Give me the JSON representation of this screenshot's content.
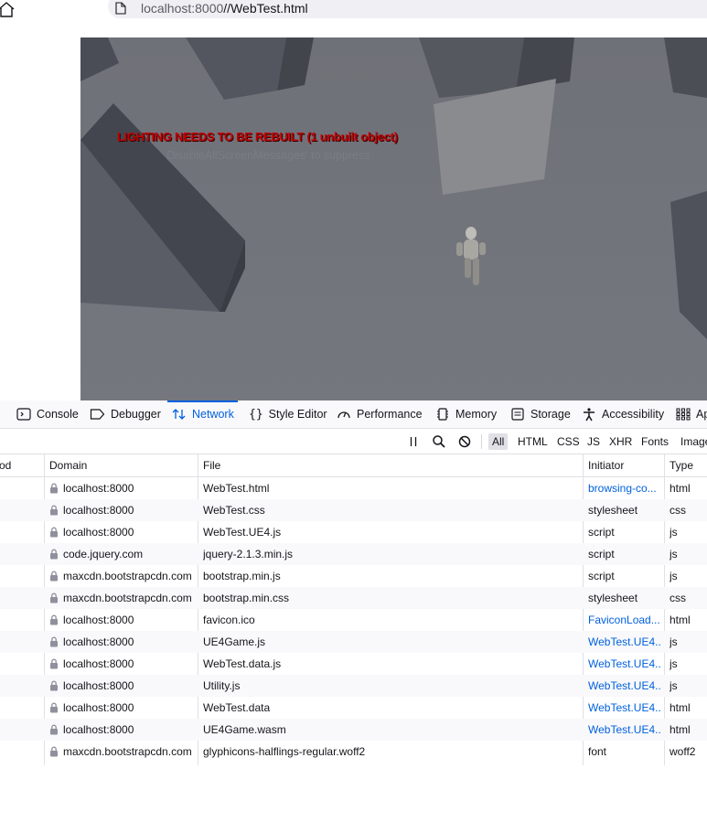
{
  "browser": {
    "url_host": "localhost:8000",
    "url_path": "//WebTest.html"
  },
  "game": {
    "message_red": "LIGHTING NEEDS TO BE REBUILT (1 unbuilt object)",
    "message_gray": "DisableAllScreenMessages' to suppress"
  },
  "devtools": {
    "tabs": [
      {
        "label": "Console",
        "icon": "console-icon"
      },
      {
        "label": "Debugger",
        "icon": "debugger-icon"
      },
      {
        "label": "Network",
        "icon": "network-icon",
        "active": true
      },
      {
        "label": "Style Editor",
        "icon": "style-editor-icon"
      },
      {
        "label": "Performance",
        "icon": "performance-icon"
      },
      {
        "label": "Memory",
        "icon": "memory-icon"
      },
      {
        "label": "Storage",
        "icon": "storage-icon"
      },
      {
        "label": "Accessibility",
        "icon": "accessibility-icon"
      },
      {
        "label": "Ap",
        "icon": "application-icon"
      }
    ],
    "filters": [
      "All",
      "HTML",
      "CSS",
      "JS",
      "XHR",
      "Fonts",
      "Image"
    ],
    "active_filter": "All",
    "columns": [
      "od",
      "Domain",
      "File",
      "Initiator",
      "Type"
    ],
    "requests": [
      {
        "domain": "localhost:8000",
        "file": "WebTest.html",
        "initiator": "browsing-co...",
        "initiator_link": true,
        "type": "html"
      },
      {
        "domain": "localhost:8000",
        "file": "WebTest.css",
        "initiator": "stylesheet",
        "initiator_link": false,
        "type": "css"
      },
      {
        "domain": "localhost:8000",
        "file": "WebTest.UE4.js",
        "initiator": "script",
        "initiator_link": false,
        "type": "js"
      },
      {
        "domain": "code.jquery.com",
        "file": "jquery-2.1.3.min.js",
        "initiator": "script",
        "initiator_link": false,
        "type": "js"
      },
      {
        "domain": "maxcdn.bootstrapcdn.com",
        "file": "bootstrap.min.js",
        "initiator": "script",
        "initiator_link": false,
        "type": "js"
      },
      {
        "domain": "maxcdn.bootstrapcdn.com",
        "file": "bootstrap.min.css",
        "initiator": "stylesheet",
        "initiator_link": false,
        "type": "css"
      },
      {
        "domain": "localhost:8000",
        "file": "favicon.ico",
        "initiator": "FaviconLoad...",
        "initiator_link": true,
        "type": "html"
      },
      {
        "domain": "localhost:8000",
        "file": "UE4Game.js",
        "initiator": "WebTest.UE4...",
        "initiator_link": true,
        "type": "js"
      },
      {
        "domain": "localhost:8000",
        "file": "WebTest.data.js",
        "initiator": "WebTest.UE4...",
        "initiator_link": true,
        "type": "js"
      },
      {
        "domain": "localhost:8000",
        "file": "Utility.js",
        "initiator": "WebTest.UE4...",
        "initiator_link": true,
        "type": "js"
      },
      {
        "domain": "localhost:8000",
        "file": "WebTest.data",
        "initiator": "WebTest.UE4...",
        "initiator_link": true,
        "type": "html"
      },
      {
        "domain": "localhost:8000",
        "file": "UE4Game.wasm",
        "initiator": "WebTest.UE4...",
        "initiator_link": true,
        "type": "html"
      },
      {
        "domain": "maxcdn.bootstrapcdn.com",
        "file": "glyphicons-halflings-regular.woff2",
        "initiator": "font",
        "initiator_link": false,
        "type": "woff2"
      }
    ]
  }
}
